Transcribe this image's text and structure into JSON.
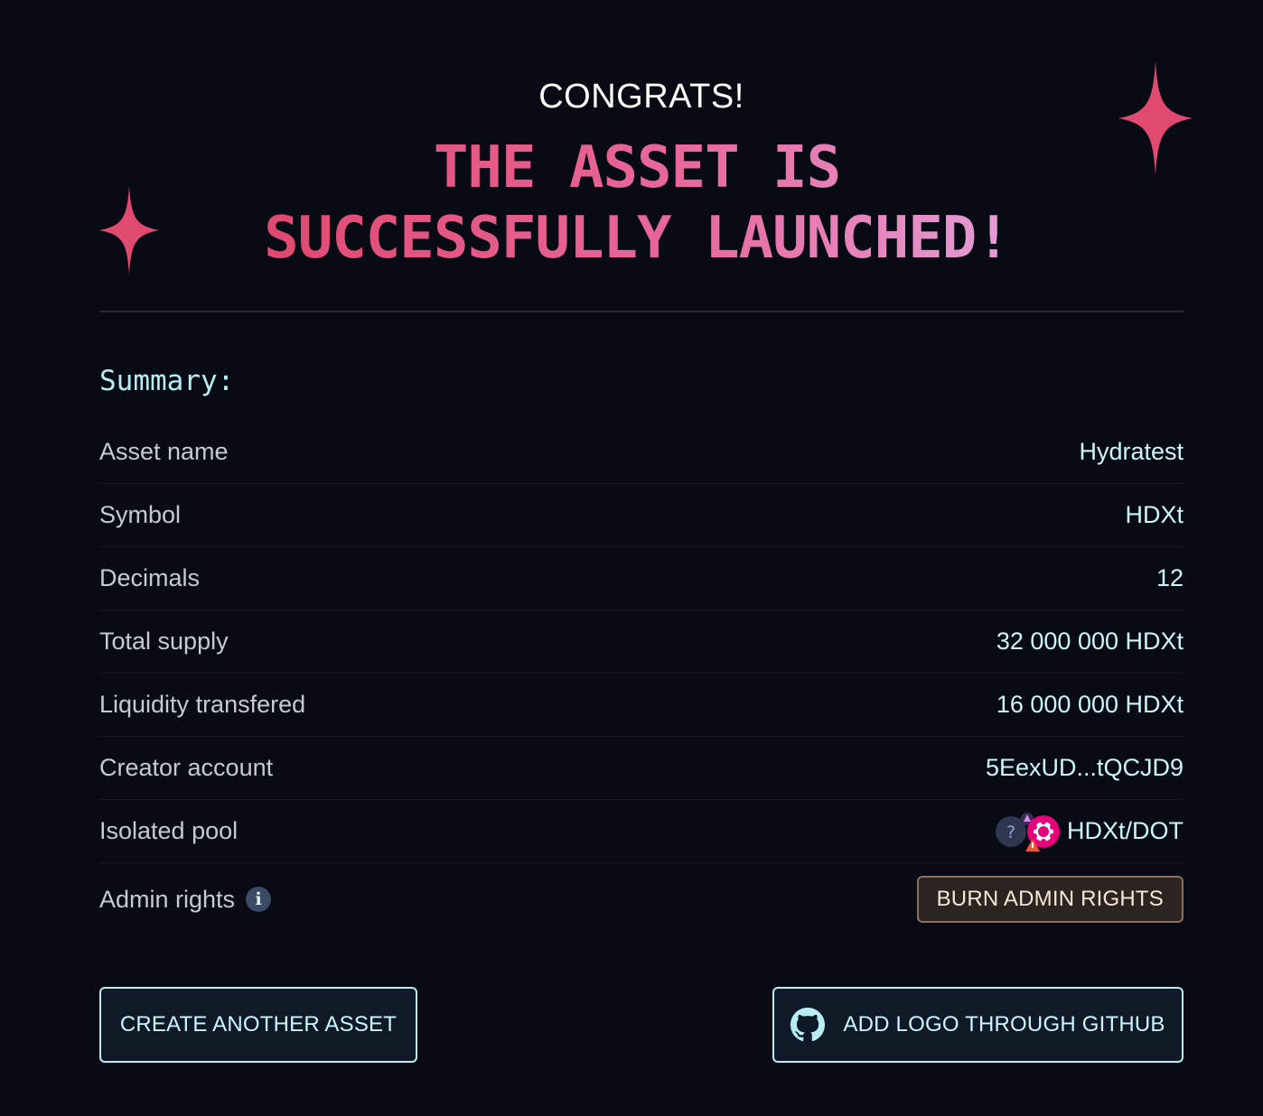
{
  "header": {
    "congrats": "CONGRATS!",
    "headline_line1": "THE ASSET IS",
    "headline_line2": "SUCCESSFULLY LAUNCHED!"
  },
  "summary": {
    "title": "Summary:",
    "rows": [
      {
        "label": "Asset name",
        "value": "Hydratest"
      },
      {
        "label": "Symbol",
        "value": "HDXt"
      },
      {
        "label": "Decimals",
        "value": "12"
      },
      {
        "label": "Total supply",
        "value": "32 000 000 HDXt"
      },
      {
        "label": "Liquidity transfered",
        "value": "16 000 000 HDXt"
      },
      {
        "label": "Creator account",
        "value": "5EexUD...tQCJD9"
      },
      {
        "label": "Isolated pool",
        "value": "HDXt/DOT"
      },
      {
        "label": "Admin rights",
        "value": ""
      }
    ],
    "burn_button": "BURN ADMIN RIGHTS",
    "info_icon": "i",
    "pool_unknown_icon": "?"
  },
  "actions": {
    "create_another": "CREATE ANOTHER ASSET",
    "add_logo": "ADD LOGO THROUGH GITHUB"
  },
  "icons": {
    "sparkle": "sparkle-icon",
    "info": "info-icon",
    "github": "github-icon",
    "unknown_asset": "unknown-asset-icon",
    "dot": "polkadot-icon",
    "warning": "warning-icon"
  },
  "colors": {
    "background": "#080b14",
    "accent_pink": "#e0486f",
    "accent_lilac": "#e3a3dd",
    "text_cyan": "#cdf5fb",
    "sparkle": "#e04a70",
    "burn_button_bg": "#2c2420",
    "burn_button_border": "#8b6f5d"
  }
}
